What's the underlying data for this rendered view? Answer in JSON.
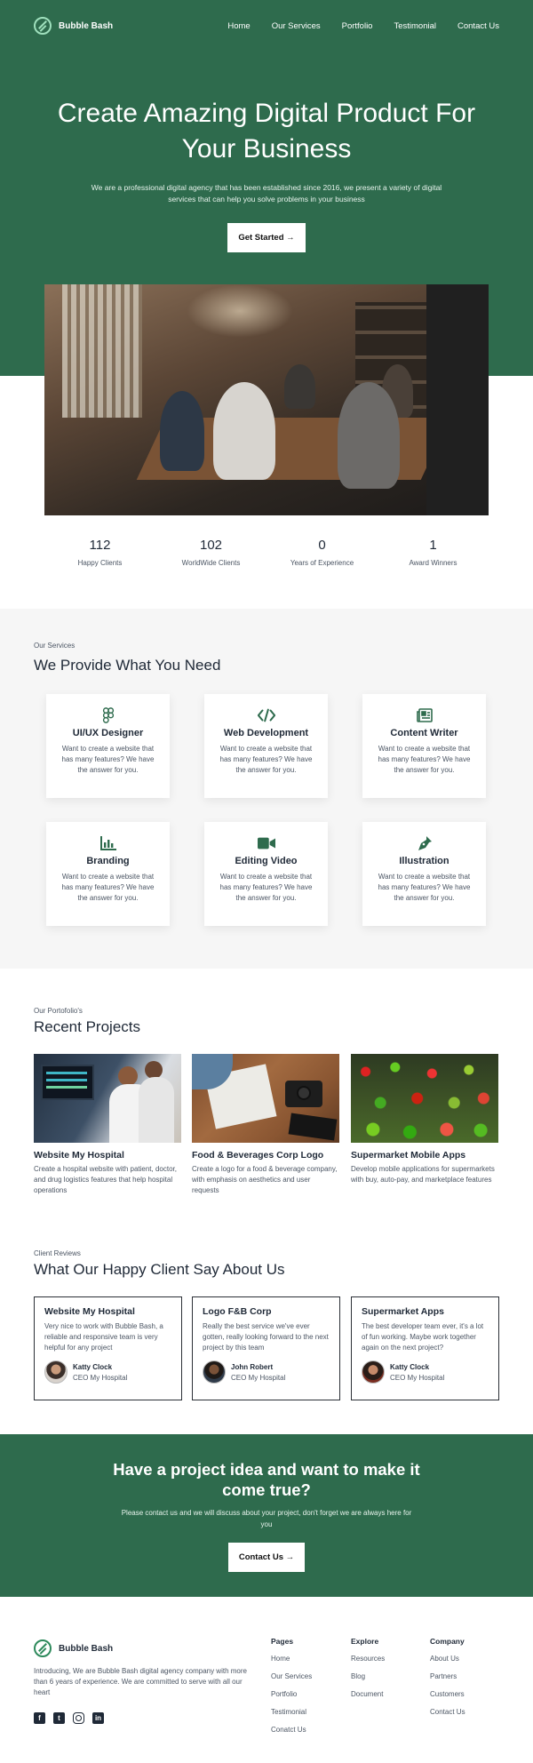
{
  "brand": {
    "name": "Bubble Bash"
  },
  "nav": {
    "items": [
      "Home",
      "Our Services",
      "Portfolio",
      "Testimonial",
      "Contact Us"
    ]
  },
  "hero": {
    "title": "Create Amazing Digital Product For Your Business",
    "subtitle": "We are a professional digital agency that has been established since 2016, we present a variety of digital services that can help you solve problems in your business",
    "cta_label": "Get Started →"
  },
  "stats": [
    {
      "value": "112",
      "label": "Happy Clients"
    },
    {
      "value": "102",
      "label": "WorldWide Clients"
    },
    {
      "value": "0",
      "label": "Years of Experience"
    },
    {
      "value": "1",
      "label": "Award Winners"
    }
  ],
  "services": {
    "eyebrow": "Our Services",
    "title": "We Provide What You Need",
    "items": [
      {
        "title": "UI/UX Designer",
        "icon": "figma-icon",
        "desc": "Want to create a website that has many features? We have the answer for you."
      },
      {
        "title": "Web Development",
        "icon": "code-icon",
        "desc": "Want to create a website that has many features? We have the answer for you."
      },
      {
        "title": "Content Writer",
        "icon": "newspaper-icon",
        "desc": "Want to create a website that has many features? We have the answer for you."
      },
      {
        "title": "Branding",
        "icon": "bar-chart-icon",
        "desc": "Want to create a website that has many features? We have the answer for you."
      },
      {
        "title": "Editing Video",
        "icon": "video-camera-icon",
        "desc": "Want to create a website that has many features? We have the answer for you."
      },
      {
        "title": "Illustration",
        "icon": "pen-nib-icon",
        "desc": "Want to create a website that has many features? We have the answer for you."
      }
    ]
  },
  "projects": {
    "eyebrow": "Our Portofolio's",
    "title": "Recent Projects",
    "items": [
      {
        "title": "Website My Hospital",
        "desc": "Create a hospital website with patient, doctor, and drug logistics features that help hospital operations"
      },
      {
        "title": "Food & Beverages Corp Logo",
        "desc": "Create a logo for a food & beverage company, with emphasis on aesthetics and user requests"
      },
      {
        "title": "Supermarket Mobile Apps",
        "desc": "Develop mobile applications for supermarkets with buy, auto-pay, and marketplace features"
      }
    ]
  },
  "reviews": {
    "eyebrow": "Client Reviews",
    "title": "What Our Happy Client Say About Us",
    "items": [
      {
        "title": "Website My Hospital",
        "text": "Very nice to work with Bubble Bash, a reliable and responsive team is very helpful for any project",
        "name": "Katty Clock",
        "role": "CEO My Hospital"
      },
      {
        "title": "Logo F&B Corp",
        "text": "Really the best service we've ever gotten, really looking forward to the next project by this team",
        "name": "John Robert",
        "role": "CEO My Hospital"
      },
      {
        "title": "Supermarket Apps",
        "text": "The best developer team ever, it's a lot of fun working. Maybe work together again on the next project?",
        "name": "Katty Clock",
        "role": "CEO My Hospital"
      }
    ]
  },
  "cta": {
    "title": "Have a project idea and want to make it come true?",
    "subtitle": "Please contact us and we will discuss about your project, don't forget we are always here for you",
    "button_label": "Contact Us →"
  },
  "footer": {
    "about": "Introducing, We are Bubble Bash digital agency company with more than 6 years of experience. We are committed to serve with all our heart",
    "socials": [
      "facebook-icon",
      "twitter-icon",
      "instagram-icon",
      "linkedin-icon"
    ],
    "columns": [
      {
        "heading": "Pages",
        "links": [
          "Home",
          "Our Services",
          "Portfolio",
          "Testimonial",
          "Conatct Us"
        ]
      },
      {
        "heading": "Explore",
        "links": [
          "Resources",
          "Blog",
          "Document"
        ]
      },
      {
        "heading": "Company",
        "links": [
          "About Us",
          "Partners",
          "Customers",
          "Contact Us"
        ]
      }
    ]
  },
  "colors": {
    "brand_green": "#2e6b4d",
    "light_bg": "#f6f6f6",
    "text_dark": "#1f2937"
  }
}
